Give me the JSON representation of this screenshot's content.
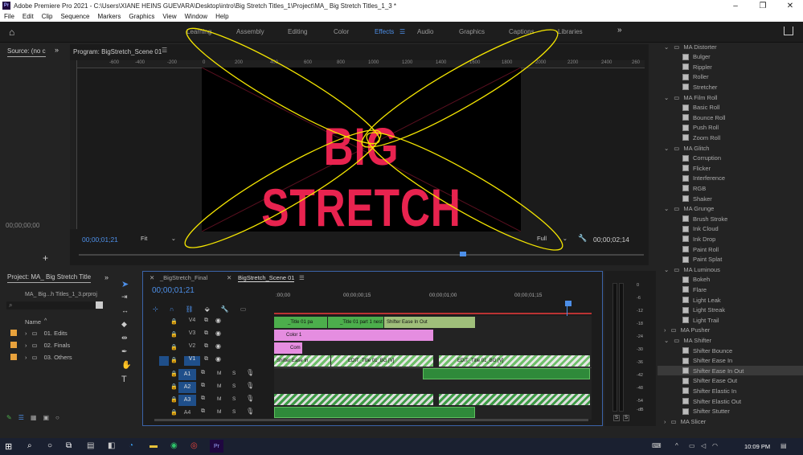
{
  "app": {
    "window_title": "Adobe Premiere Pro 2021 - C:\\Users\\XIANE HEINS GUEVARA\\Desktop\\intro\\Big Stretch Titles_1\\Project\\MA_ Big Stretch Titles_1_3 *",
    "logo": "Pr"
  },
  "menu": [
    "File",
    "Edit",
    "Clip",
    "Sequence",
    "Markers",
    "Graphics",
    "View",
    "Window",
    "Help"
  ],
  "workspaces": {
    "tabs": [
      "Learning",
      "Assembly",
      "Editing",
      "Color",
      "Effects",
      "Audio",
      "Graphics",
      "Captions",
      "Libraries"
    ],
    "active": "Effects",
    "more": "»"
  },
  "source_panel": {
    "title": "Source: (no c",
    "timecode": "00;00;00;00"
  },
  "program_monitor": {
    "title": "Program: BigStretch_Scene 01",
    "ruler": [
      "-600",
      "-400",
      "-200",
      "0",
      "200",
      "400",
      "600",
      "800",
      "1000",
      "1200",
      "1400",
      "1600",
      "1800",
      "2000",
      "2200",
      "2400",
      "260"
    ],
    "canvas_text": "BIG STRETCH",
    "timecode_current": "00;00;01;21",
    "timecode_duration": "00;00;02;14",
    "zoom": "Fit",
    "resolution": "Full",
    "playhead_fraction": 0.68
  },
  "project_panel": {
    "title": "Project: MA_ Big Stretch Title",
    "file": "MA_ Big...h Titles_1_3.prproj",
    "column_name": "Name",
    "folders": [
      "01. Edits",
      "02. Finals",
      "03. Others"
    ]
  },
  "timeline": {
    "tabs": [
      "_BigStretch_Final",
      "BigStretch_Scene 01"
    ],
    "active_tab": "BigStretch_Scene 01",
    "timecode": "00;00;01;21",
    "ruler": [
      ":00;00",
      "00;00;00;15",
      "00;00;01;00",
      "00;00;01;15"
    ],
    "video_tracks": [
      "V4",
      "V3",
      "V2",
      "V1"
    ],
    "audio_tracks": [
      "A1",
      "A2",
      "A3",
      "A4"
    ],
    "clips": {
      "v4_a": "_Title 01 pa",
      "v4_b": "_Title 01 part 1 nest",
      "v4_c": "Shifter Ease In Out",
      "v3": "Color 1",
      "v2": "Com",
      "v1_a": "Shifter Ease In",
      "v1_b": "EDIT_Title 01_BG [V]",
      "v1_c": "EDIT_Title 01_BG [V]"
    }
  },
  "audio_meter": {
    "scale": [
      "0",
      "-6",
      "-12",
      "-18",
      "-24",
      "-30",
      "-36",
      "-42",
      "-48",
      "-54",
      "-dB"
    ],
    "solo": [
      "S",
      "S"
    ]
  },
  "effects_panel": {
    "groups": [
      {
        "name": "MA Distorter",
        "items": [
          "Bulger",
          "Rippler",
          "Roller",
          "Stretcher"
        ]
      },
      {
        "name": "MA Film Roll",
        "items": [
          "Basic Roll",
          "Bounce Roll",
          "Push Roll",
          "Zoom Roll"
        ]
      },
      {
        "name": "MA Glitch",
        "items": [
          "Corruption",
          "Flicker",
          "Interference",
          "RGB",
          "Shaker"
        ]
      },
      {
        "name": "MA Grunge",
        "items": [
          "Brush Stroke",
          "Ink Cloud",
          "Ink Drop",
          "Paint Roll",
          "Paint Splat"
        ]
      },
      {
        "name": "MA Luminous",
        "items": [
          "Bokeh",
          "Flare",
          "Light Leak",
          "Light Streak",
          "Light Trail"
        ]
      },
      {
        "name": "MA Pusher",
        "items": []
      },
      {
        "name": "MA Shifter",
        "items": [
          "Shifter Bounce",
          "Shifter Ease In",
          "Shifter Ease In Out",
          "Shifter Ease Out",
          "Shifter Elastic In",
          "Shifter Elastic Out",
          "Shifter Stutter"
        ]
      },
      {
        "name": "MA Slicer",
        "items": []
      }
    ],
    "selected": "Shifter Ease In Out"
  },
  "taskbar": {
    "time": "10:09 PM"
  },
  "colors": {
    "accent": "#4d8fe8",
    "title_red": "#e8234f",
    "annotation": "#f5e600",
    "clip_green": "#4cae4c",
    "clip_pink": "#e58de0"
  }
}
